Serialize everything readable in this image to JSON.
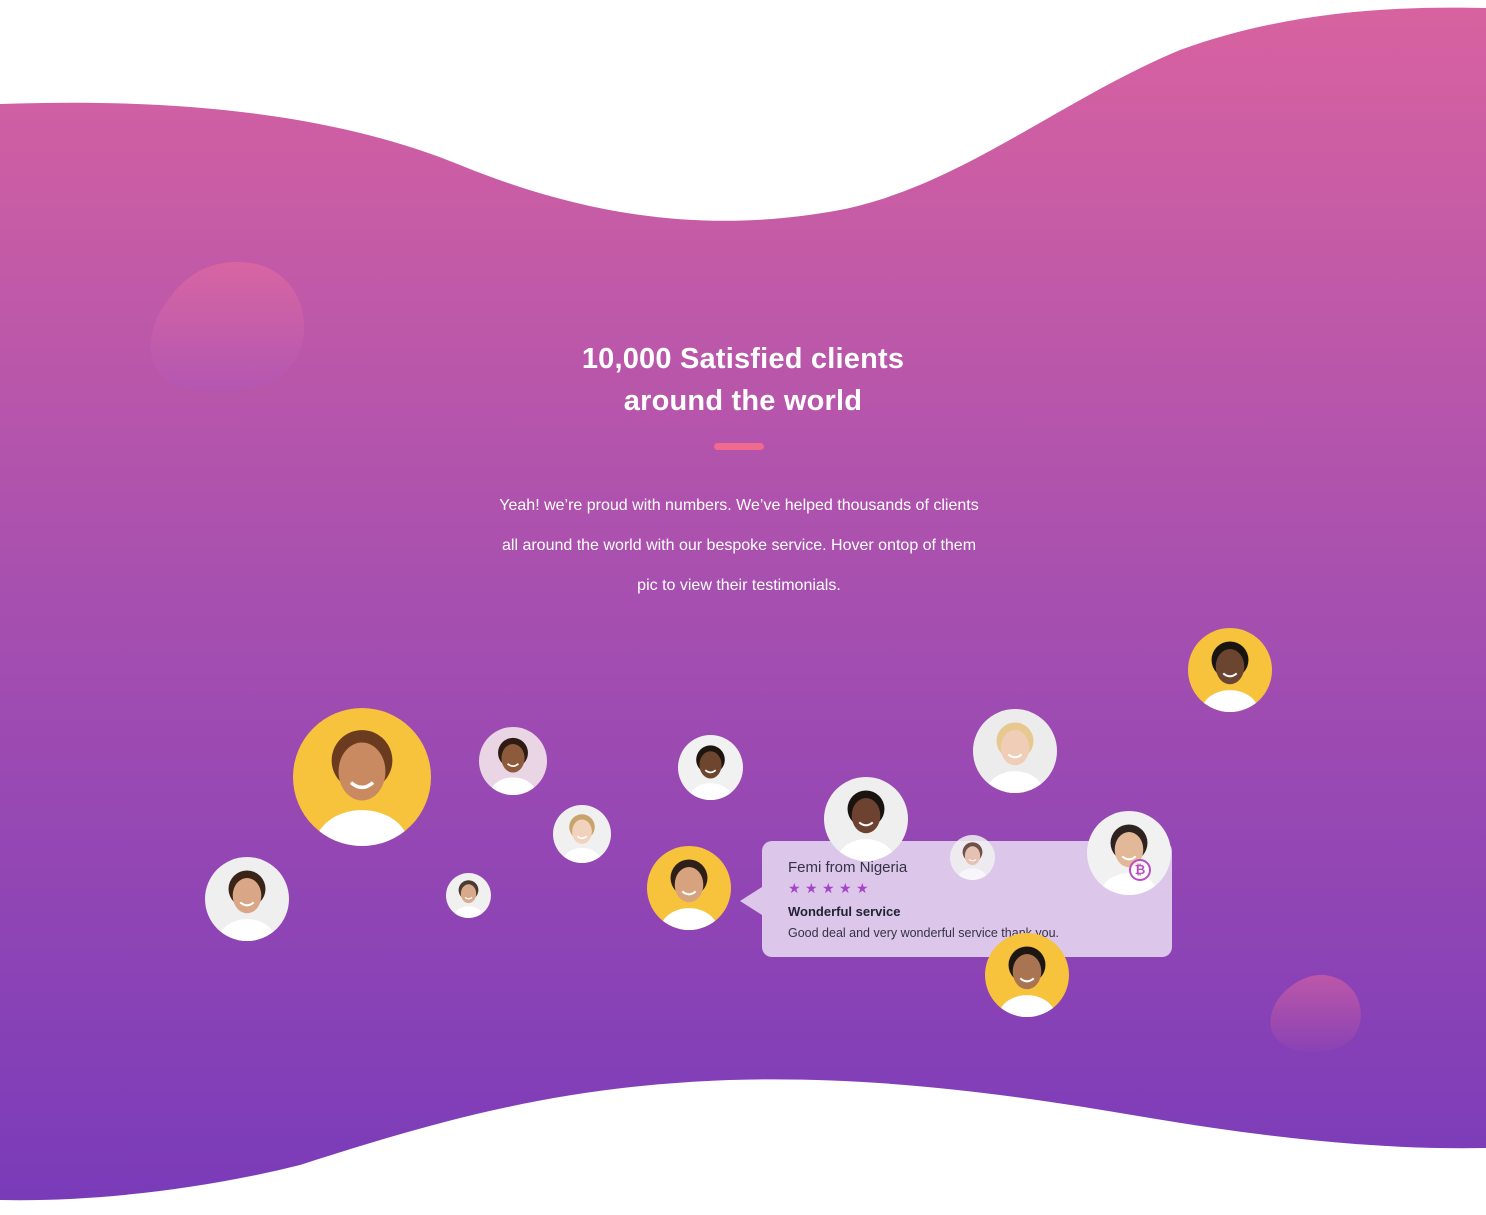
{
  "section": {
    "heading_line1": "10,000 Satisfied clients",
    "heading_line2": "around the world",
    "description_line1": "Yeah! we’re proud with numbers. We’ve helped thousands of clients",
    "description_line2": "all around the world with our bespoke service. Hover ontop of them",
    "description_line3": "pic to view their testimonials."
  },
  "colors": {
    "gradient_top": "#d760a1",
    "gradient_bottom": "#7b3bb8",
    "accent": "#f06a8e",
    "tooltip_bg": "#dcc6ea",
    "star": "#a645c8"
  },
  "testimonial": {
    "name": "Femi from Nigeria",
    "rating": 5,
    "title": "Wonderful service",
    "text": "Good deal and very wonderful service thank you.",
    "star_icon": "star-icon"
  },
  "avatars": [
    {
      "name": "client-woman-headphones",
      "bg": "#f7c23c",
      "skin": "#c98a62",
      "hair": "#6b3b1f"
    },
    {
      "name": "client-woman-curly",
      "bg": "#e9d5e3",
      "skin": "#8e5a3c",
      "hair": "#2d1b14"
    },
    {
      "name": "client-man-laughing",
      "bg": "#f1f1f1",
      "skin": "#6e4630",
      "hair": "#1e1410"
    },
    {
      "name": "client-woman-hat",
      "bg": "#ececec",
      "skin": "#f0cdb6",
      "hair": "#e6c890"
    },
    {
      "name": "client-man-dancing",
      "bg": "#f7c23c",
      "skin": "#6b4530",
      "hair": "#1a1410"
    },
    {
      "name": "client-woman-blonde",
      "bg": "#f0f0f0",
      "skin": "#f1d2bd",
      "hair": "#c9a36c"
    },
    {
      "name": "client-man-smiling-femi",
      "bg": "#efefef",
      "skin": "#6e4230",
      "hair": "#1a1410"
    },
    {
      "name": "client-man-beard",
      "bg": "#efefef",
      "skin": "#d9a787",
      "hair": "#3a2418"
    },
    {
      "name": "client-man-small",
      "bg": "#f0f0f0",
      "skin": "#d8a98b",
      "hair": "#4a3a30"
    },
    {
      "name": "client-man-headset",
      "bg": "#f7c23c",
      "skin": "#d7a27e",
      "hair": "#2e2018"
    },
    {
      "name": "client-woman-small",
      "bg": "#f2f2f2",
      "skin": "#e6c1a9",
      "hair": "#5b3c2a"
    },
    {
      "name": "client-man-glasses-bitcoin",
      "bg": "#f1f1f1",
      "skin": "#e3b898",
      "hair": "#2e2320"
    },
    {
      "name": "client-man-glasses-yellow",
      "bg": "#f7c23c",
      "skin": "#a97452",
      "hair": "#1e1612"
    }
  ]
}
